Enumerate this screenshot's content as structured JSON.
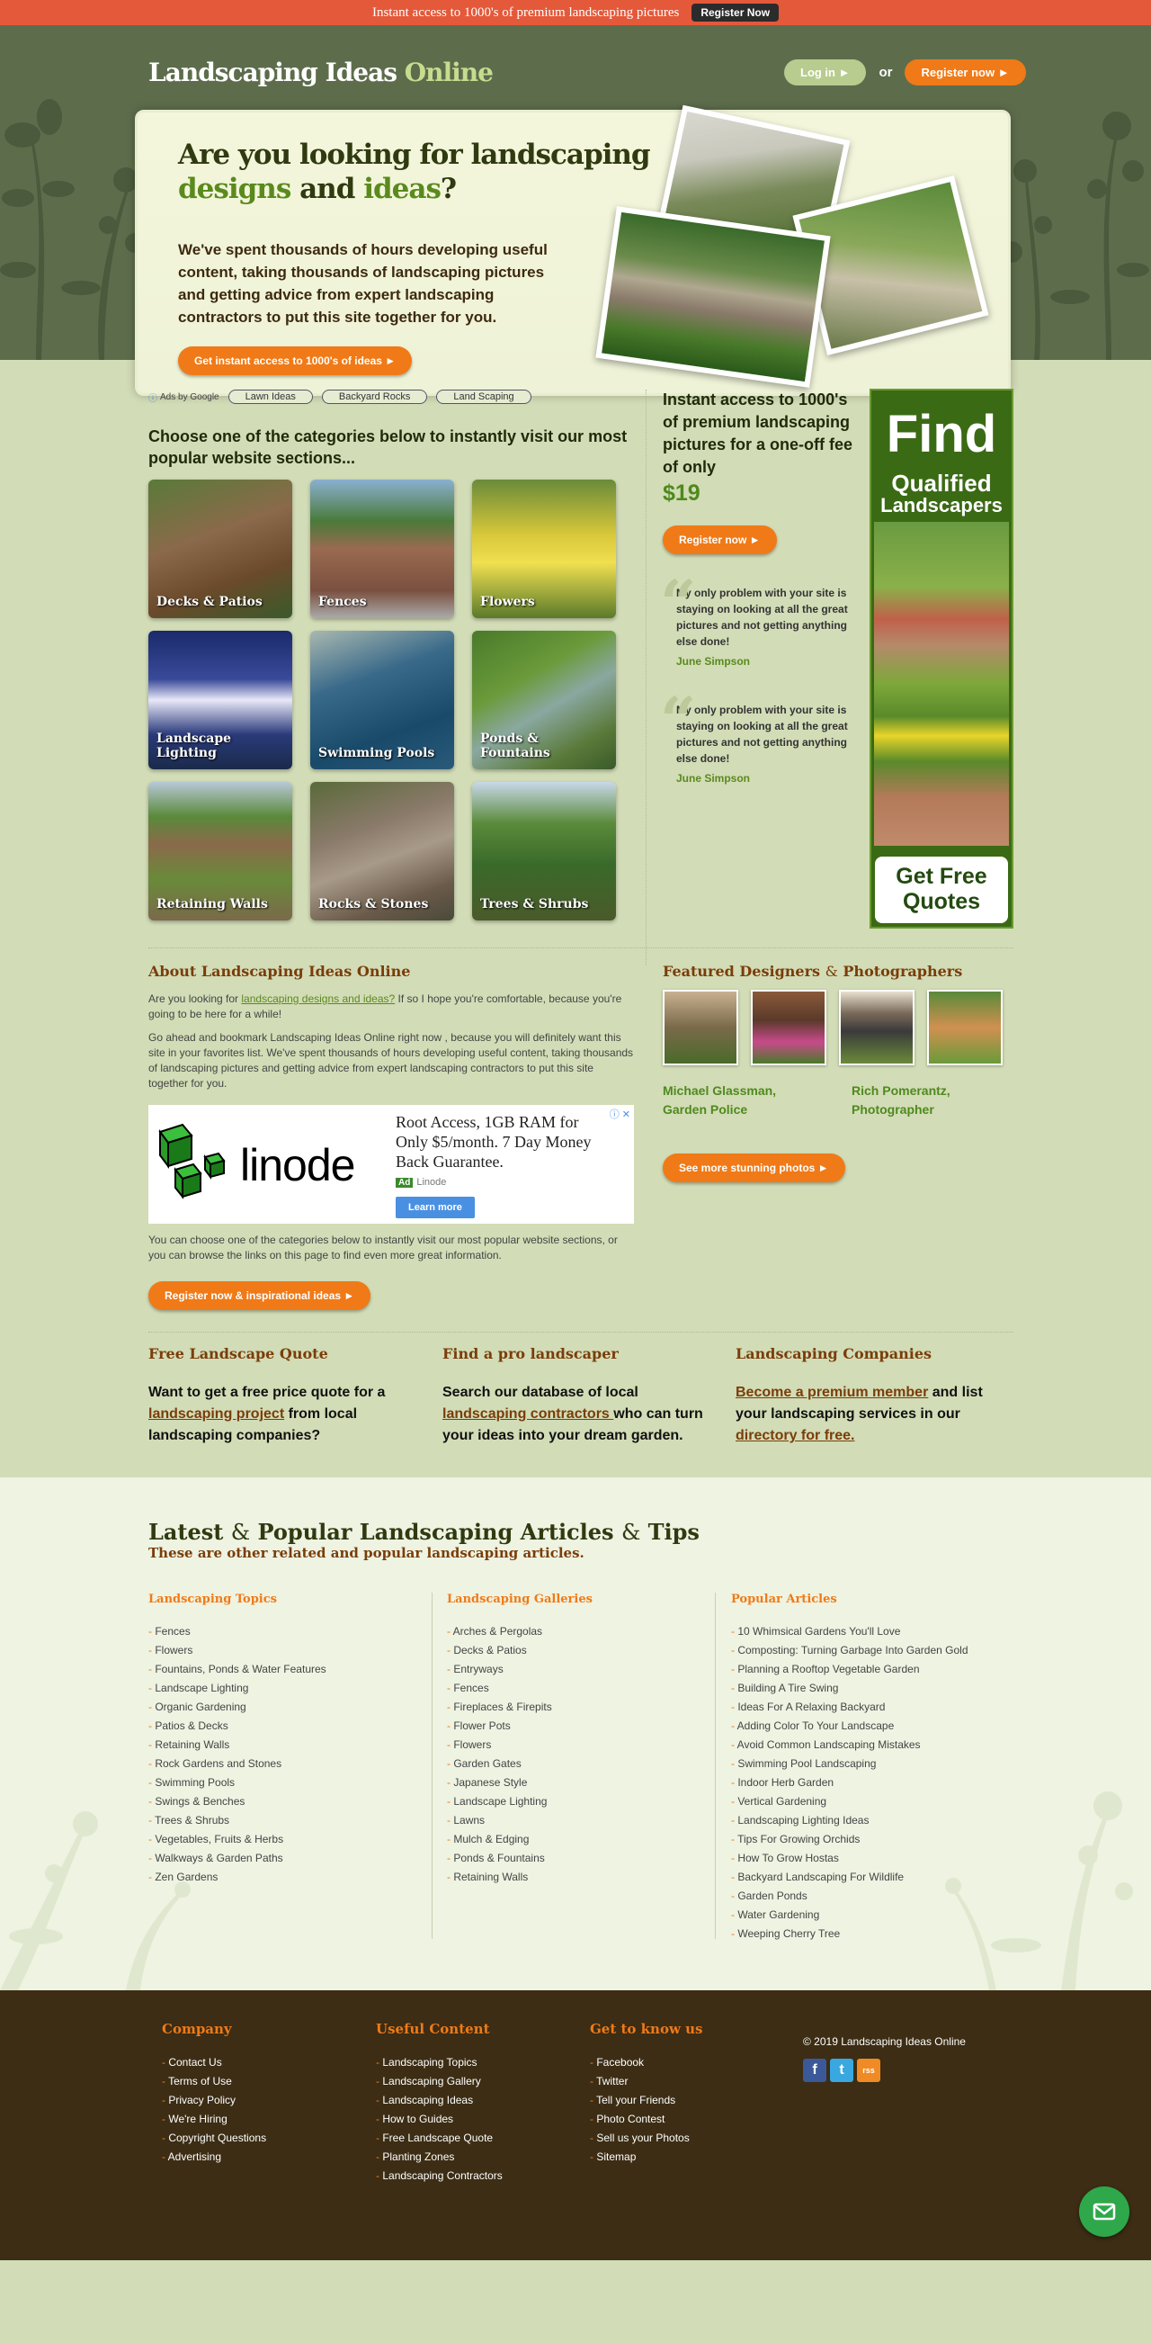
{
  "topbar": {
    "text": "Instant access to 1000's of premium landscaping pictures",
    "button": "Register Now"
  },
  "header": {
    "logo_main": "Landscaping Ideas ",
    "logo_accent": "Online",
    "login": "Log in ►",
    "or": "or",
    "register": "Register now ►"
  },
  "hero": {
    "h1_a": "Are you looking for landscaping",
    "h1_b": "designs",
    "h1_c": " and ",
    "h1_d": "ideas",
    "h1_e": "?",
    "body": "We've spent thousands of hours developing useful content, taking thousands of landscaping pictures and getting advice from expert landscaping contractors to put this site together for you.",
    "cta": "Get instant access to 1000's of ideas ►"
  },
  "ads": {
    "label": "Ads by Google",
    "chips": [
      "Lawn Ideas",
      "Backyard Rocks",
      "Land Scaping"
    ]
  },
  "categories": {
    "title": "Choose one of the categories below to instantly visit our most popular website sections...",
    "items": [
      "Decks & Patios",
      "Fences",
      "Flowers",
      "Landscape Lighting",
      "Swimming Pools",
      "Ponds & Fountains",
      "Retaining Walls",
      "Rocks & Stones",
      "Trees & Shrubs"
    ]
  },
  "offer": {
    "text": "Instant access to 1000's of premium landscaping pictures for a one-off fee of only",
    "price": "$19",
    "button": "Register now ►"
  },
  "testimonials": [
    {
      "text": "My only problem with your site is staying on looking at all the great pictures and not getting anything else done!",
      "who": "June Simpson"
    },
    {
      "text": "My only problem with your site is staying on looking at all the great pictures and not getting anything else done!",
      "who": "June Simpson"
    }
  ],
  "skyscraper": {
    "find": "Find",
    "q1": "Qualified",
    "q2": "Landscapers",
    "cta1": "Get Free",
    "cta2": "Quotes"
  },
  "about": {
    "title": "About Landscaping Ideas Online",
    "p1_a": "Are you looking for ",
    "p1_link": "landscaping designs and ideas?",
    "p1_b": " If so I hope you're comfortable, because you're going to be here for a while!",
    "p2": "Go ahead and bookmark Landscaping Ideas Online right now , because you will definitely want this site in your favorites list. We've spent thousands of hours developing useful content, taking thousands of landscaping pictures and getting advice from expert landscaping contractors to put this site together for you.",
    "p3": "You can choose one of the categories below to instantly visit our most popular website sections, or you can browse the links on this page to find even more great information.",
    "button": "Register now & inspirational ideas ►"
  },
  "linode_ad": {
    "brand": "linode",
    "text": "Root Access, 1GB RAM for Only $5/month. 7 Day Money Back Guarantee.",
    "ad": "Ad",
    "advertiser": "Linode",
    "button": "Learn more",
    "close": "ⓘ ✕"
  },
  "featured": {
    "title_a": "Featured Designers ",
    "title_amp": "&",
    "title_b": " Photographers",
    "people": [
      "Michael Glassman, Garden Police",
      "Rich Pomerantz, Photographer"
    ],
    "button": "See more stunning photos ►"
  },
  "cols": [
    {
      "title": "Free Landscape Quote",
      "a": "Want to get a free price quote for a ",
      "link": "landscaping project",
      "b": " from local landscaping companies?"
    },
    {
      "title": "Find a pro landscaper",
      "a": "Search our database of local ",
      "link": "landscaping contractors ",
      "b": "who can turn your ideas into your dream garden."
    },
    {
      "title": "Landscaping Companies",
      "a": "",
      "link": "Become a premium member",
      "b": " and list your landscaping services in our ",
      "link2": "directory for free."
    }
  ],
  "articles": {
    "title_a": "Latest ",
    "amp": "&",
    "title_b": " Popular Landscaping Articles ",
    "amp2": "&",
    "title_c": " Tips",
    "subtitle": "These are other related and popular landscaping articles.",
    "topics": {
      "title": "Landscaping Topics",
      "items": [
        "Fences",
        "Flowers",
        "Fountains, Ponds & Water Features",
        "Landscape Lighting",
        "Organic Gardening",
        "Patios & Decks",
        "Retaining Walls",
        "Rock Gardens and Stones",
        "Swimming Pools",
        "Swings & Benches",
        "Trees & Shrubs",
        "Vegetables, Fruits & Herbs",
        "Walkways & Garden Paths",
        "Zen Gardens"
      ]
    },
    "galleries": {
      "title": "Landscaping Galleries",
      "items": [
        "Arches & Pergolas",
        "Decks & Patios",
        "Entryways",
        "Fences",
        "Fireplaces & Firepits",
        "Flower Pots",
        "Flowers",
        "Garden Gates",
        "Japanese Style",
        "Landscape Lighting",
        "Lawns",
        "Mulch & Edging",
        "Ponds & Fountains",
        "Retaining Walls"
      ]
    },
    "popular": {
      "title": "Popular Articles",
      "items": [
        "10 Whimsical Gardens You'll Love",
        "Composting: Turning Garbage Into Garden Gold",
        "Planning a Rooftop Vegetable Garden",
        "Building A Tire Swing",
        "Ideas For A Relaxing Backyard",
        "Adding Color To Your Landscape",
        "Avoid Common Landscaping Mistakes",
        "Swimming Pool Landscaping",
        "Indoor Herb Garden",
        "Vertical Gardening",
        "Landscaping Lighting Ideas",
        "Tips For Growing Orchids",
        "How To Grow Hostas",
        "Backyard Landscaping For Wildlife",
        "Garden Ponds",
        "Water Gardening",
        "Weeping Cherry Tree"
      ]
    }
  },
  "footer": {
    "company": {
      "title": "Company",
      "items": [
        "Contact Us",
        "Terms of Use",
        "Privacy Policy",
        "We're Hiring",
        "Copyright Questions",
        "Advertising"
      ]
    },
    "useful": {
      "title": "Useful Content",
      "items": [
        "Landscaping Topics",
        "Landscaping Gallery",
        "Landscaping Ideas",
        "How to Guides",
        "Free Landscape Quote",
        "Planting Zones",
        "Landscaping Contractors"
      ]
    },
    "know": {
      "title": "Get to know us",
      "items": [
        "Facebook",
        "Twitter",
        "Tell your Friends",
        "Photo Contest",
        "Sell us your Photos",
        "Sitemap"
      ]
    },
    "copyright": "© 2019 Landscaping Ideas Online",
    "social": [
      "f",
      "t",
      "rss"
    ]
  },
  "colors": {
    "accent": "#f07a17",
    "green": "#5a8a1d",
    "brown": "#7a3d0a",
    "header": "#5d6d4c",
    "footer": "#3c2d14"
  }
}
